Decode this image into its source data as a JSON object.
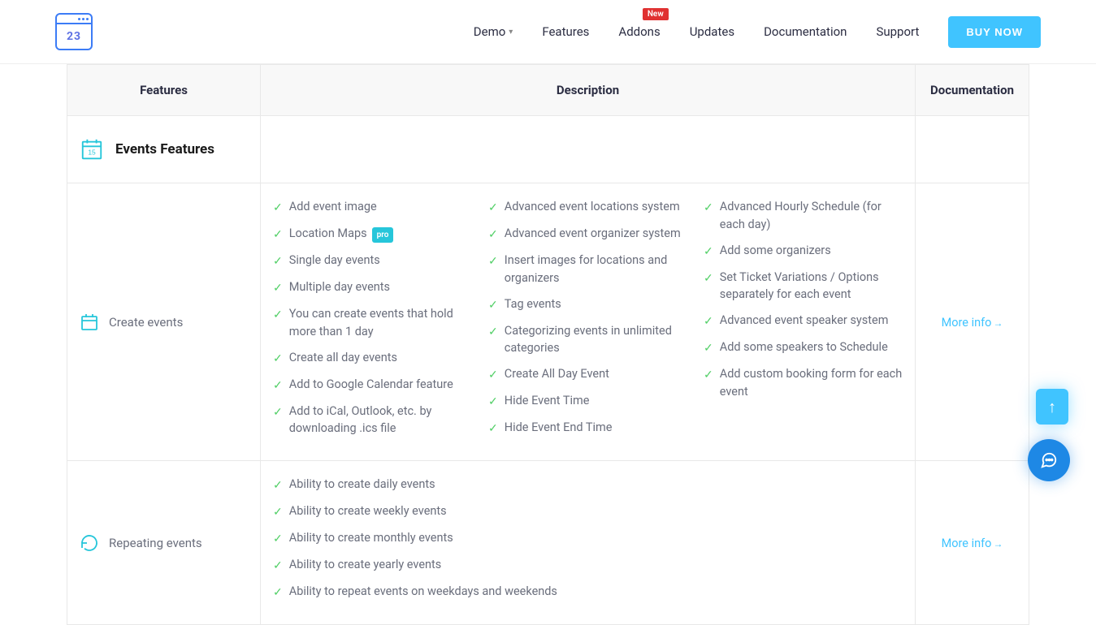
{
  "logo": {
    "text": "23"
  },
  "nav": {
    "items": [
      {
        "label": "Demo",
        "has_dropdown": true
      },
      {
        "label": "Features"
      },
      {
        "label": "Addons",
        "badge": "New"
      },
      {
        "label": "Updates"
      },
      {
        "label": "Documentation"
      },
      {
        "label": "Support"
      }
    ],
    "cta": "BUY NOW"
  },
  "table": {
    "headers": {
      "features": "Features",
      "description": "Description",
      "documentation": "Documentation"
    },
    "section": {
      "title": "Events Features"
    },
    "rows": [
      {
        "label": "Create events",
        "col1": [
          {
            "text": "Add event image"
          },
          {
            "text": "Location Maps",
            "pro": true
          },
          {
            "text": "Single day events"
          },
          {
            "text": "Multiple day events"
          },
          {
            "text": "You can create events that hold more than 1 day"
          },
          {
            "text": "Create all day events"
          },
          {
            "text": "Add to Google Calendar feature"
          },
          {
            "text": "Add to iCal, Outlook, etc. by downloading .ics file"
          }
        ],
        "col2": [
          {
            "text": "Advanced event locations system"
          },
          {
            "text": "Advanced event organizer system"
          },
          {
            "text": "Insert images for locations and organizers"
          },
          {
            "text": "Tag events"
          },
          {
            "text": "Categorizing events in unlimited categories"
          },
          {
            "text": "Create All Day Event"
          },
          {
            "text": "Hide Event Time"
          },
          {
            "text": "Hide Event End Time"
          }
        ],
        "col3": [
          {
            "text": "Advanced Hourly Schedule (for each day)"
          },
          {
            "text": "Add some organizers"
          },
          {
            "text": "Set Ticket Variations / Options separately for each event"
          },
          {
            "text": "Advanced event speaker system"
          },
          {
            "text": "Add some speakers to Schedule"
          },
          {
            "text": "Add custom booking form for each event"
          }
        ],
        "more": "More info"
      },
      {
        "label": "Repeating events",
        "col1": [
          {
            "text": "Ability to create daily events"
          },
          {
            "text": "Ability to create weekly events"
          },
          {
            "text": "Ability to create monthly events"
          },
          {
            "text": "Ability to create yearly events"
          },
          {
            "text": "Ability to repeat events on weekdays and weekends"
          }
        ],
        "col2": [],
        "col3": [],
        "more": "More info"
      }
    ],
    "pro_label": "pro"
  }
}
